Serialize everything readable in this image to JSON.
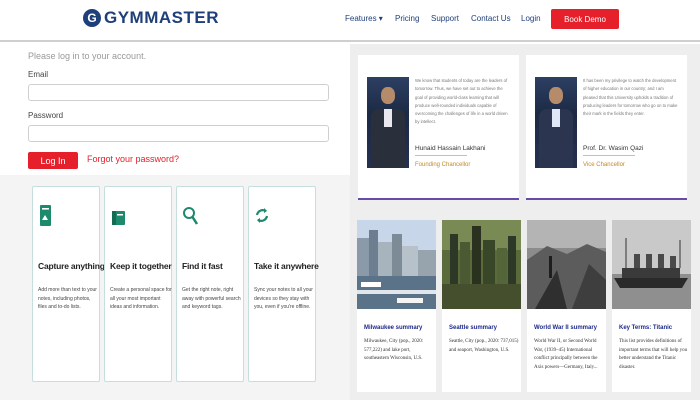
{
  "header": {
    "logo_mark": "G",
    "logo_text": "GYMMASTER",
    "nav": [
      {
        "label": "Features ▾"
      },
      {
        "label": "Pricing"
      },
      {
        "label": "Support"
      },
      {
        "label": "Contact Us"
      },
      {
        "label": "Login"
      }
    ],
    "demo_button": "Book Demo"
  },
  "login": {
    "intro": "Please log in to your account.",
    "email_label": "Email",
    "email_value": "",
    "password_label": "Password",
    "password_value": "",
    "login_button": "Log In",
    "forgot_link": "Forgot your password?"
  },
  "features": [
    {
      "icon": "note-page-icon",
      "title": "Capture anything",
      "desc": "Add more than text to your notes, including photos, files and to-do lists."
    },
    {
      "icon": "notebook-icon",
      "title": "Keep it together",
      "desc": "Create a personal space for all your most important ideas and information."
    },
    {
      "icon": "search-icon",
      "title": "Find it fast",
      "desc": "Get the right note, right away with powerful search and keyword tags."
    },
    {
      "icon": "sync-icon",
      "title": "Take it anywhere",
      "desc": "Sync your notes to all your devices so they stay with you, even if you're offline."
    }
  ],
  "chancellors": [
    {
      "text": "We know that students of today are the leaders of tomorrow. Thus, we have set out to achieve the goal of providing world-class learning that will produce well-rounded individuals capable of overcoming the challenges of life in a world driven by intellect.",
      "name": "Hunaid Hassain Lakhani",
      "role": "Founding Chancellor"
    },
    {
      "text": "It has been my privilege to watch the development of higher education in our country; and I am pleased that this University upholds a tradition of producing leaders for tomorrow who go on to make their mark in the fields they enter.",
      "name": "Prof. Dr. Wasim Qazi",
      "role": "Vice Chancellor"
    }
  ],
  "articles": [
    {
      "title": "Milwaukee summary",
      "desc": "Milwaukee, City (pop., 2020: 577,222) and lake port, southeastern Wisconsin, U.S."
    },
    {
      "title": "Seattle summary",
      "desc": "Seattle, City (pop., 2020: 737,015) and seaport, Washington, U.S."
    },
    {
      "title": "World War II summary",
      "desc": "World War II, or Second World War, (1939–45) International conflict principally between the Axis powers—Germany, Italy..."
    },
    {
      "title": "Key Terms: Titanic",
      "desc": "This list provides definitions of important terms that will help you better understand the Titanic disaster."
    }
  ],
  "colors": {
    "brand_blue": "#1f3f7a",
    "accent_red": "#e5202a",
    "divider_purple": "#6a4aa5"
  }
}
